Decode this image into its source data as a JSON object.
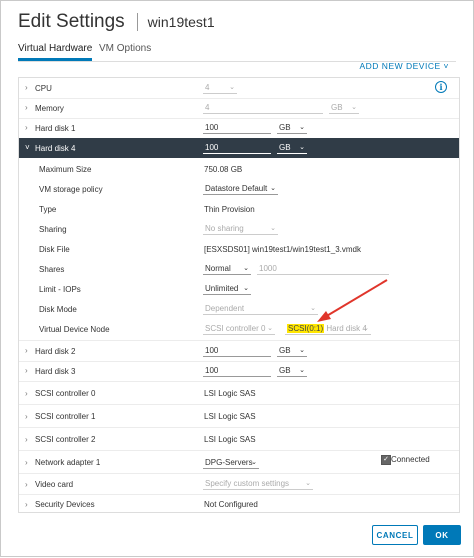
{
  "header": {
    "title": "Edit Settings",
    "vm_name": "win19test1"
  },
  "tabs": [
    {
      "label": "Virtual Hardware"
    },
    {
      "label": "VM Options"
    }
  ],
  "toolbar": {
    "add_device_label": "ADD NEW DEVICE",
    "info_icon": "i"
  },
  "rows": {
    "cpu": {
      "label": "CPU",
      "value": "4"
    },
    "memory": {
      "label": "Memory",
      "value": "4",
      "unit": "GB"
    },
    "hd1": {
      "label": "Hard disk 1",
      "value": "100",
      "unit": "GB"
    },
    "hd4": {
      "label": "Hard disk 4",
      "value": "100",
      "unit": "GB",
      "max_size_label": "Maximum Size",
      "max_size_value": "750.08 GB",
      "policy_label": "VM storage policy",
      "policy_value": "Datastore Default",
      "type_label": "Type",
      "type_value": "Thin Provision",
      "sharing_label": "Sharing",
      "sharing_value": "No sharing",
      "file_label": "Disk File",
      "file_value": "[ESXSDS01] win19test1/win19test1_3.vmdk",
      "shares_label": "Shares",
      "shares_value": "Normal",
      "shares_num": "1000",
      "iops_label": "Limit - IOPs",
      "iops_value": "Unlimited",
      "mode_label": "Disk Mode",
      "mode_value": "Dependent",
      "node_label": "Virtual Device Node",
      "node_controller": "SCSI controller 0",
      "node_id": "SCSI(0:1)",
      "node_disk": "Hard disk 4"
    },
    "hd2": {
      "label": "Hard disk 2",
      "value": "100",
      "unit": "GB"
    },
    "hd3": {
      "label": "Hard disk 3",
      "value": "100",
      "unit": "GB"
    },
    "scsi0": {
      "label": "SCSI controller 0",
      "value": "LSI Logic SAS"
    },
    "scsi1": {
      "label": "SCSI controller 1",
      "value": "LSI Logic SAS"
    },
    "scsi2": {
      "label": "SCSI controller 2",
      "value": "LSI Logic SAS"
    },
    "net1": {
      "label": "Network adapter 1",
      "value": "DPG-Servers",
      "connected_label": "Connected"
    },
    "video": {
      "label": "Video card",
      "value": "Specify custom settings"
    },
    "security": {
      "label": "Security Devices",
      "value": "Not Configured"
    }
  },
  "footer": {
    "cancel_label": "CANCEL",
    "ok_label": "OK"
  },
  "colors": {
    "accent": "#0079b8",
    "selected_row": "#303c47",
    "highlight": "#ffe600",
    "arrow": "#e0352b"
  },
  "icons": {
    "collapsed": "chevron-right-icon",
    "expanded": "chevron-down-icon",
    "dropdown": "caret-down-icon",
    "annotation": "red-arrow-icon"
  }
}
